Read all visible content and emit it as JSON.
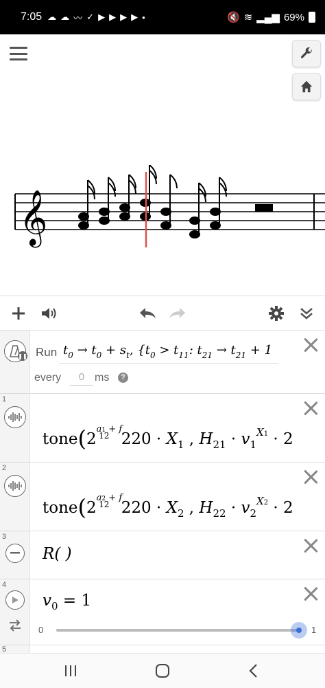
{
  "status_bar": {
    "time": "7:05",
    "battery": "69%"
  },
  "ticker": {
    "run_label": "Run",
    "every_label": "every",
    "interval_value": "0",
    "unit_label": "ms"
  },
  "expressions": {
    "row1": {
      "number": "1"
    },
    "row2": {
      "number": "2"
    },
    "row3": {
      "number": "3",
      "text": "R( )"
    },
    "row4": {
      "number": "4",
      "slider_min": "0",
      "slider_max": "1",
      "slider_value": 1
    },
    "row5": {
      "number": "5"
    }
  },
  "colors": {
    "playhead": "#d9534f",
    "slider_accent": "#3a6fd8"
  }
}
